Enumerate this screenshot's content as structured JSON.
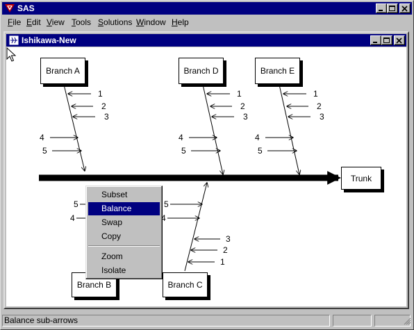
{
  "app": {
    "title": "SAS"
  },
  "menubar": {
    "items": [
      {
        "hot": "F",
        "rest": "ile"
      },
      {
        "hot": "E",
        "rest": "dit"
      },
      {
        "hot": "V",
        "rest": "iew"
      },
      {
        "hot": "T",
        "rest": "ools"
      },
      {
        "hot": "S",
        "rest": "olutions"
      },
      {
        "hot": "W",
        "rest": "indow"
      },
      {
        "hot": "H",
        "rest": "elp"
      }
    ]
  },
  "child_window": {
    "title": "Ishikawa-New"
  },
  "diagram": {
    "trunk_label": "Trunk",
    "branches": {
      "a": "Branch A",
      "b": "Branch B",
      "c": "Branch C",
      "d": "Branch D",
      "e": "Branch E"
    },
    "sub_arrow_labels": {
      "top_right": [
        "1",
        "2",
        "3"
      ],
      "top_left": [
        "4",
        "5"
      ],
      "bottom_c_right": [
        "3",
        "2",
        "1"
      ],
      "bottom_c_left": [
        "5",
        "4"
      ],
      "bottom_b_left": [
        "5",
        "4"
      ]
    }
  },
  "context_menu": {
    "items": [
      "Subset",
      "Balance",
      "Swap",
      "Copy",
      "Zoom",
      "Isolate"
    ],
    "selected": "Balance"
  },
  "statusbar": {
    "message": "Balance sub-arrows"
  },
  "colors": {
    "titlebar": "#000080",
    "face": "#c0c0c0",
    "canvas": "#ffffff"
  }
}
